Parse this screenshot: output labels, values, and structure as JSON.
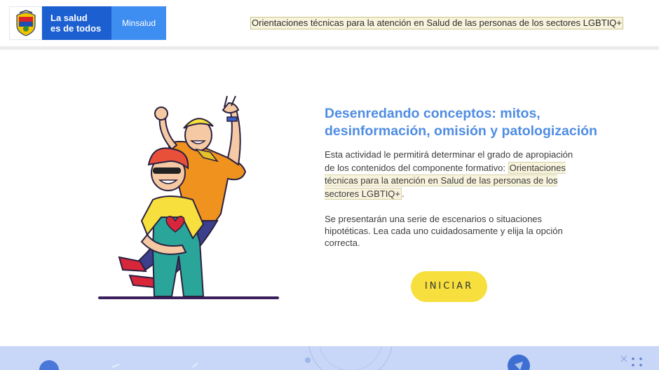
{
  "header": {
    "logo_line1": "La salud",
    "logo_line2": "es de todos",
    "logo_ministry": "Minsalud",
    "course_link": "Orientaciones técnicas para la atención en Salud de las personas de los sectores LGBTIQ+"
  },
  "main": {
    "title": "Desenredando conceptos: mitos, desinformación, omisión y patologización",
    "intro_text": "Esta actividad le permitirá determinar el grado de apropiación de los contenidos del componente formativo: ",
    "intro_link": "Orientaciones técnicas para la atención en Salud de las personas de los sectores LGBTIQ+",
    "intro_end": ".",
    "instructions": "Se presentarán una serie de escenarios o situaciones hipotéticas. Lea cada uno cuidadosamente y elija la opción correcta.",
    "start_button": "INICIAR"
  },
  "colors": {
    "accent_blue": "#4f8de3",
    "logo_blue": "#1b5fd1",
    "logo_light_blue": "#3e8df0",
    "button_yellow": "#f7df3d",
    "footer_band": "#c8d7f8"
  },
  "icons": {
    "logo_emblem": "colombia-coat-of-arms-icon",
    "illustration": "two-friends-celebrating-illustration"
  }
}
